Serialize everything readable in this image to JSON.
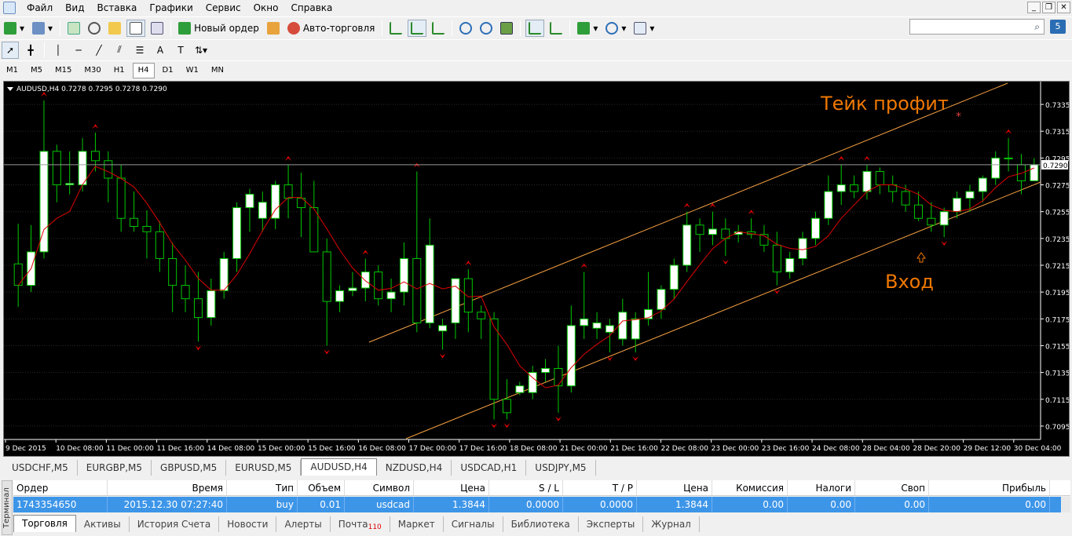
{
  "menu": [
    "Файл",
    "Вид",
    "Вставка",
    "Графики",
    "Сервис",
    "Окно",
    "Справка"
  ],
  "toolbar": {
    "new_order": "Новый ордер",
    "auto_trading": "Авто-торговля",
    "badge": "5"
  },
  "timeframes": [
    "M1",
    "M5",
    "M15",
    "M30",
    "H1",
    "H4",
    "D1",
    "W1",
    "MN"
  ],
  "selected_timeframe": "H4",
  "chart": {
    "header": "AUDUSD,H4  0.7278 0.7295 0.7278 0.7290",
    "current_price": "0.7290",
    "annotation_tp": "Тейк профит",
    "annotation_entry": "Вход",
    "colors": {
      "bull": "#ffffff",
      "bear": "#000000",
      "wick": "#00c800",
      "ma": "#e00000",
      "channel": "#f5a040",
      "fractal": "#e00000",
      "text": "#f07800",
      "axis": "#ffffff",
      "bg": "#000000"
    }
  },
  "chart_data": {
    "type": "candlestick",
    "symbol": "AUDUSD",
    "timeframe": "H4",
    "ylim": [
      0.7085,
      0.7345
    ],
    "y_ticks": [
      "0.7335",
      "0.7315",
      "0.7295",
      "0.7275",
      "0.7255",
      "0.7235",
      "0.7215",
      "0.7195",
      "0.7175",
      "0.7155",
      "0.7135",
      "0.7115",
      "0.7095"
    ],
    "x_ticks": [
      "9 Dec 2015",
      "10 Dec 08:00",
      "11 Dec 00:00",
      "11 Dec 16:00",
      "14 Dec 08:00",
      "15 Dec 00:00",
      "15 Dec 16:00",
      "16 Dec 08:00",
      "17 Dec 00:00",
      "17 Dec 16:00",
      "18 Dec 08:00",
      "21 Dec 00:00",
      "21 Dec 16:00",
      "22 Dec 08:00",
      "23 Dec 00:00",
      "23 Dec 16:00",
      "24 Dec 08:00",
      "28 Dec 04:00",
      "28 Dec 20:00",
      "29 Dec 12:00",
      "30 Dec 04:00"
    ],
    "candles": [
      [
        0.7216,
        0.7246,
        0.7184,
        0.72
      ],
      [
        0.72,
        0.7245,
        0.7195,
        0.7225
      ],
      [
        0.7225,
        0.7338,
        0.722,
        0.73
      ],
      [
        0.73,
        0.7305,
        0.7262,
        0.7275
      ],
      [
        0.7275,
        0.73,
        0.7268,
        0.7276
      ],
      [
        0.7275,
        0.731,
        0.727,
        0.73
      ],
      [
        0.73,
        0.7314,
        0.7285,
        0.7293
      ],
      [
        0.7293,
        0.73,
        0.7262,
        0.728
      ],
      [
        0.728,
        0.729,
        0.724,
        0.725
      ],
      [
        0.725,
        0.727,
        0.724,
        0.7244
      ],
      [
        0.7244,
        0.7256,
        0.722,
        0.724
      ],
      [
        0.724,
        0.7248,
        0.721,
        0.722
      ],
      [
        0.722,
        0.7232,
        0.718,
        0.72
      ],
      [
        0.72,
        0.7215,
        0.718,
        0.719
      ],
      [
        0.719,
        0.721,
        0.7158,
        0.7176
      ],
      [
        0.7176,
        0.7205,
        0.717,
        0.7196
      ],
      [
        0.7196,
        0.7225,
        0.719,
        0.722
      ],
      [
        0.722,
        0.7262,
        0.721,
        0.7258
      ],
      [
        0.7258,
        0.7272,
        0.724,
        0.7268
      ],
      [
        0.725,
        0.727,
        0.724,
        0.7262
      ],
      [
        0.725,
        0.7278,
        0.7242,
        0.7275
      ],
      [
        0.7275,
        0.729,
        0.725,
        0.7265
      ],
      [
        0.7265,
        0.7284,
        0.7236,
        0.7258
      ],
      [
        0.7258,
        0.7278,
        0.7232,
        0.7225
      ],
      [
        0.7225,
        0.7235,
        0.7155,
        0.7188
      ],
      [
        0.7188,
        0.72,
        0.718,
        0.7196
      ],
      [
        0.7196,
        0.721,
        0.7192,
        0.7198
      ],
      [
        0.7198,
        0.722,
        0.7188,
        0.721
      ],
      [
        0.721,
        0.7215,
        0.7185,
        0.719
      ],
      [
        0.719,
        0.7205,
        0.718,
        0.7195
      ],
      [
        0.7195,
        0.7232,
        0.7185,
        0.722
      ],
      [
        0.722,
        0.7285,
        0.7165,
        0.7172
      ],
      [
        0.7172,
        0.725,
        0.7168,
        0.723
      ],
      [
        0.7166,
        0.7175,
        0.7152,
        0.717
      ],
      [
        0.7172,
        0.7205,
        0.716,
        0.7205
      ],
      [
        0.7205,
        0.7212,
        0.7165,
        0.718
      ],
      [
        0.718,
        0.7185,
        0.716,
        0.7175
      ],
      [
        0.7175,
        0.718,
        0.71,
        0.7115
      ],
      [
        0.7115,
        0.713,
        0.71,
        0.7105
      ],
      [
        0.712,
        0.7128,
        0.7118,
        0.7125
      ],
      [
        0.712,
        0.714,
        0.7115,
        0.7135
      ],
      [
        0.7135,
        0.7145,
        0.7128,
        0.7138
      ],
      [
        0.7138,
        0.7155,
        0.7105,
        0.7125
      ],
      [
        0.7125,
        0.7185,
        0.712,
        0.717
      ],
      [
        0.717,
        0.721,
        0.716,
        0.7175
      ],
      [
        0.7168,
        0.718,
        0.716,
        0.7172
      ],
      [
        0.7165,
        0.7175,
        0.715,
        0.717
      ],
      [
        0.716,
        0.719,
        0.7155,
        0.718
      ],
      [
        0.716,
        0.718,
        0.715,
        0.7175
      ],
      [
        0.7175,
        0.721,
        0.717,
        0.7182
      ],
      [
        0.7182,
        0.72,
        0.7175,
        0.7197
      ],
      [
        0.7197,
        0.722,
        0.719,
        0.7215
      ],
      [
        0.7215,
        0.7255,
        0.721,
        0.7245
      ],
      [
        0.7245,
        0.725,
        0.7225,
        0.7238
      ],
      [
        0.7238,
        0.7255,
        0.723,
        0.7242
      ],
      [
        0.7242,
        0.725,
        0.7222,
        0.7235
      ],
      [
        0.7238,
        0.7245,
        0.7232,
        0.724
      ],
      [
        0.724,
        0.725,
        0.7235,
        0.7238
      ],
      [
        0.7238,
        0.7245,
        0.7225,
        0.723
      ],
      [
        0.723,
        0.724,
        0.72,
        0.721
      ],
      [
        0.721,
        0.7225,
        0.7205,
        0.722
      ],
      [
        0.722,
        0.724,
        0.7215,
        0.7235
      ],
      [
        0.7235,
        0.7255,
        0.723,
        0.725
      ],
      [
        0.725,
        0.7282,
        0.7245,
        0.727
      ],
      [
        0.727,
        0.729,
        0.726,
        0.7275
      ],
      [
        0.7275,
        0.7282,
        0.7265,
        0.727
      ],
      [
        0.727,
        0.729,
        0.7264,
        0.7285
      ],
      [
        0.7285,
        0.7288,
        0.7268,
        0.7275
      ],
      [
        0.7275,
        0.7282,
        0.7262,
        0.727
      ],
      [
        0.727,
        0.7275,
        0.7255,
        0.726
      ],
      [
        0.726,
        0.727,
        0.7248,
        0.725
      ],
      [
        0.725,
        0.7262,
        0.724,
        0.7245
      ],
      [
        0.7245,
        0.7258,
        0.7236,
        0.7255
      ],
      [
        0.7255,
        0.727,
        0.725,
        0.7265
      ],
      [
        0.7265,
        0.7275,
        0.7255,
        0.727
      ],
      [
        0.727,
        0.7282,
        0.7262,
        0.728
      ],
      [
        0.728,
        0.73,
        0.7275,
        0.7295
      ],
      [
        0.7295,
        0.731,
        0.7285,
        0.7295
      ],
      [
        0.729,
        0.7298,
        0.7268,
        0.7278
      ],
      [
        0.7278,
        0.7295,
        0.7278,
        0.729
      ]
    ]
  },
  "chart_tabs": [
    "USDCHF,M5",
    "EURGBP,M5",
    "GBPUSD,M5",
    "EURUSD,M5",
    "AUDUSD,H4",
    "NZDUSD,H4",
    "USDCAD,H1",
    "USDJPY,M5"
  ],
  "active_chart_tab": "AUDUSD,H4",
  "terminal": {
    "side_label": "Терминал",
    "columns": [
      "Ордер",
      "Время",
      "Тип",
      "Объем",
      "Символ",
      "Цена",
      "S / L",
      "T / P",
      "Цена",
      "Комиссия",
      "Налоги",
      "Своп",
      "Прибыль"
    ],
    "sort_indicator": "/",
    "row": [
      "1743354650",
      "2015.12.30 07:27:40",
      "buy",
      "0.01",
      "usdcad",
      "1.3844",
      "0.0000",
      "0.0000",
      "1.3844",
      "0.00",
      "0.00",
      "0.00",
      "0.00"
    ],
    "tabs": [
      "Торговля",
      "Активы",
      "История Счета",
      "Новости",
      "Алерты",
      "Почта",
      "Маркет",
      "Сигналы",
      "Библиотека",
      "Эксперты",
      "Журнал"
    ],
    "mail_count": "110",
    "active_tab": "Торговля"
  }
}
